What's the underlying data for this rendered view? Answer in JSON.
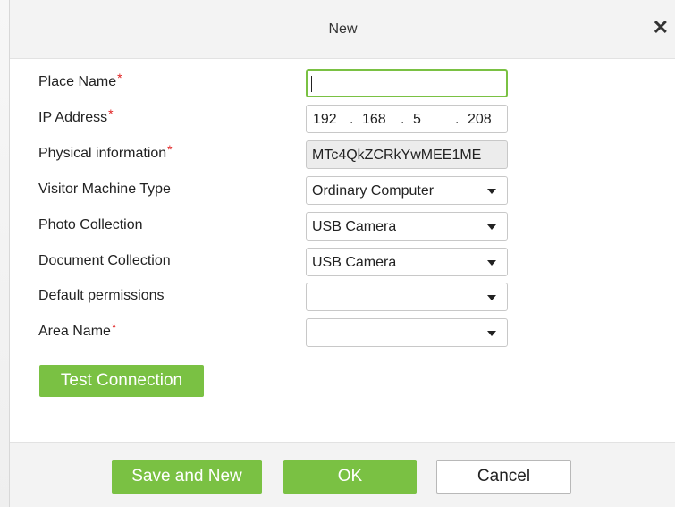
{
  "dialog": {
    "title": "New",
    "close_icon": "close-icon"
  },
  "form": {
    "place_name": {
      "label": "Place Name",
      "required": "*",
      "value": ""
    },
    "ip_address": {
      "label": "IP Address",
      "required": "*",
      "octets": [
        "192",
        "168",
        "5",
        "208"
      ],
      "separator": "."
    },
    "physical_information": {
      "label": "Physical information",
      "required": "*",
      "value": "MTc4QkZCRkYwMEE1ME"
    },
    "visitor_machine_type": {
      "label": "Visitor Machine Type",
      "value": "Ordinary Computer"
    },
    "photo_collection": {
      "label": "Photo Collection",
      "value": "USB Camera"
    },
    "document_collection": {
      "label": "Document Collection",
      "value": "USB Camera"
    },
    "default_permissions": {
      "label": "Default permissions",
      "value": ""
    },
    "area_name": {
      "label": "Area Name",
      "required": "*",
      "value": ""
    }
  },
  "buttons": {
    "test_connection": "Test Connection",
    "save_and_new": "Save and New",
    "ok": "OK",
    "cancel": "Cancel"
  },
  "colors": {
    "accent": "#7ac143",
    "required": "#e02020",
    "header_bg": "#f3f3f3"
  }
}
